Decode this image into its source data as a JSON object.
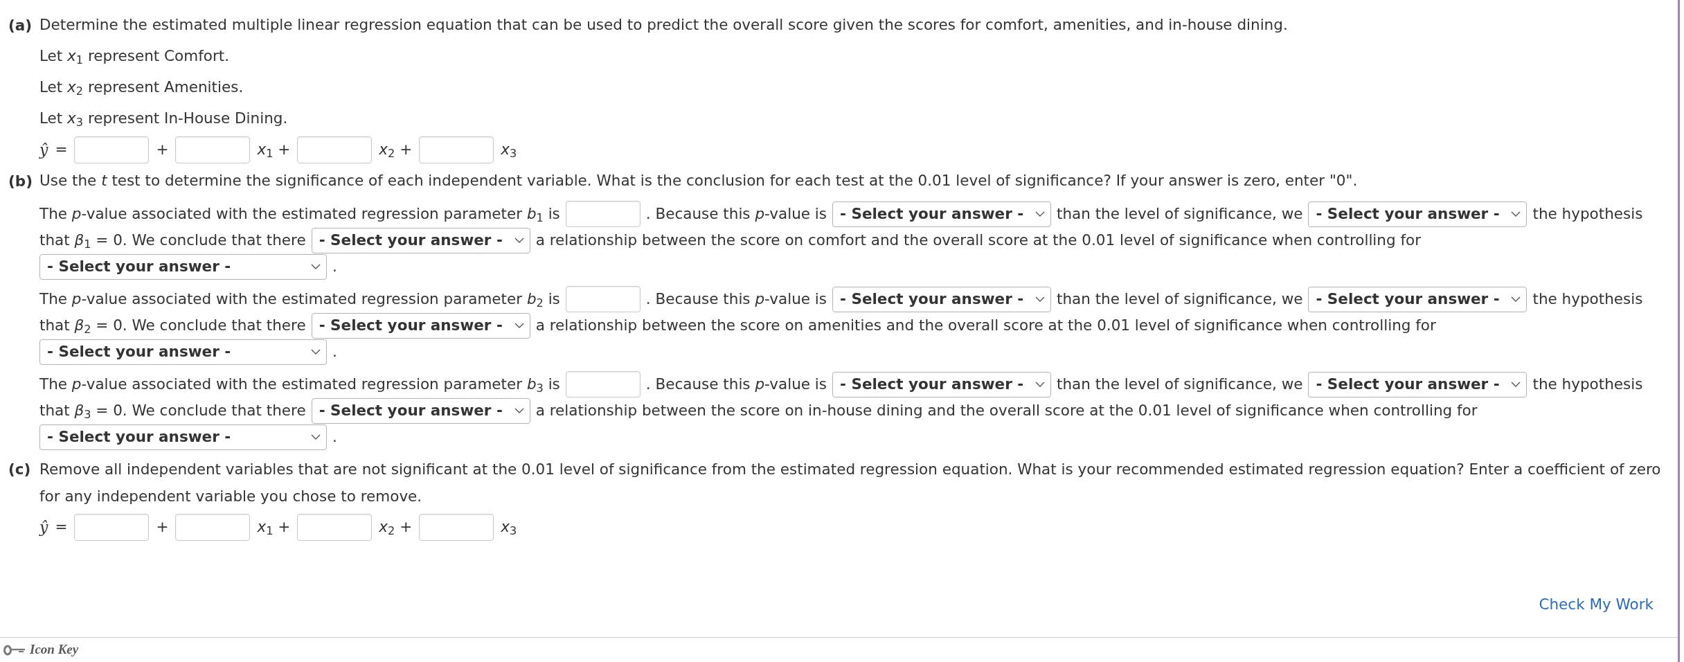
{
  "part_a": {
    "label": "(a)",
    "prompt": "Determine the estimated multiple linear regression equation that can be used to predict the overall score given the scores for comfort, amenities, and in-house dining.",
    "definitions": [
      "Let *x*$_{1}$ represent Comfort.",
      "Let *x*$_{2}$ represent Amenities.",
      "Let *x*$_{3}$ represent In-House Dining."
    ],
    "equation": {
      "lhs": "ŷ",
      "equals": "=",
      "terms": [
        {
          "after": "+"
        },
        {
          "after": "*x*$_{1}$ +"
        },
        {
          "after": "*x*$_{2}$ +"
        },
        {
          "after": "*x*$_{3}$"
        }
      ]
    }
  },
  "part_b": {
    "label": "(b)",
    "prompt": "Use the *t* test to determine the significance of each independent variable. What is the conclusion for each test at the 0.01 level of significance? If your answer is zero, enter \"0\".",
    "tests": [
      {
        "lines": [
          [
            {
              "kind": "text",
              "text": "The *p*-value associated with the estimated regression parameter *b*$_{1}$ is"
            },
            {
              "kind": "input"
            },
            {
              "kind": "text",
              "text": ". Because this *p*-value is"
            },
            {
              "kind": "select",
              "text": "- Select your answer -"
            },
            {
              "kind": "text",
              "text": "than the level of significance, we"
            },
            {
              "kind": "select",
              "text": "- Select your answer -"
            },
            {
              "kind": "text",
              "text": "the hypothesis"
            }
          ],
          [
            {
              "kind": "text",
              "text": "that *β*$_{1}$ = 0. We conclude that there"
            },
            {
              "kind": "select",
              "text": "- Select your answer -"
            },
            {
              "kind": "text",
              "text": "a relationship between the score on comfort and the overall score at the 0.01 level of significance when controlling for"
            }
          ],
          [
            {
              "kind": "long_select",
              "text": "- Select your answer -"
            },
            {
              "kind": "text",
              "text": "."
            }
          ]
        ]
      },
      {
        "lines": [
          [
            {
              "kind": "text",
              "text": "The *p*-value associated with the estimated regression parameter *b*$_{2}$ is"
            },
            {
              "kind": "input"
            },
            {
              "kind": "text",
              "text": ". Because this *p*-value is"
            },
            {
              "kind": "select",
              "text": "- Select your answer -"
            },
            {
              "kind": "text",
              "text": "than the level of significance, we"
            },
            {
              "kind": "select",
              "text": "- Select your answer -"
            },
            {
              "kind": "text",
              "text": "the hypothesis"
            }
          ],
          [
            {
              "kind": "text",
              "text": "that *β*$_{2}$ = 0. We conclude that there"
            },
            {
              "kind": "select",
              "text": "- Select your answer -"
            },
            {
              "kind": "text",
              "text": "a relationship between the score on amenities and the overall score at the 0.01 level of significance when controlling for"
            }
          ],
          [
            {
              "kind": "long_select",
              "text": "- Select your answer -"
            },
            {
              "kind": "text",
              "text": "."
            }
          ]
        ]
      },
      {
        "lines": [
          [
            {
              "kind": "text",
              "text": "The *p*-value associated with the estimated regression parameter *b*$_{3}$ is"
            },
            {
              "kind": "input"
            },
            {
              "kind": "text",
              "text": ". Because this *p*-value is"
            },
            {
              "kind": "select",
              "text": "- Select your answer -"
            },
            {
              "kind": "text",
              "text": "than the level of significance, we"
            },
            {
              "kind": "select",
              "text": "- Select your answer -"
            },
            {
              "kind": "text",
              "text": "the hypothesis"
            }
          ],
          [
            {
              "kind": "text",
              "text": "that *β*$_{3}$ = 0. We conclude that there"
            },
            {
              "kind": "select",
              "text": "- Select your answer -"
            },
            {
              "kind": "text",
              "text": "a relationship between the score on in-house dining and the overall score at the 0.01 level of significance when controlling for"
            }
          ],
          [
            {
              "kind": "long_select",
              "text": "- Select your answer -"
            },
            {
              "kind": "text",
              "text": "."
            }
          ]
        ]
      }
    ]
  },
  "part_c": {
    "label": "(c)",
    "prompt": "Remove all independent variables that are not significant at the 0.01 level of significance from the estimated regression equation. What is your recommended estimated regression equation? Enter a coefficient of zero for any independent variable you chose to remove.",
    "equation": {
      "lhs": "ŷ",
      "equals": "=",
      "terms": [
        {
          "after": "+"
        },
        {
          "after": "*x*$_{1}$ +"
        },
        {
          "after": "*x*$_{2}$ +"
        },
        {
          "after": "*x*$_{3}$"
        }
      ]
    }
  },
  "check_link": "Check My Work",
  "footer": {
    "icon_key": "Icon Key"
  }
}
